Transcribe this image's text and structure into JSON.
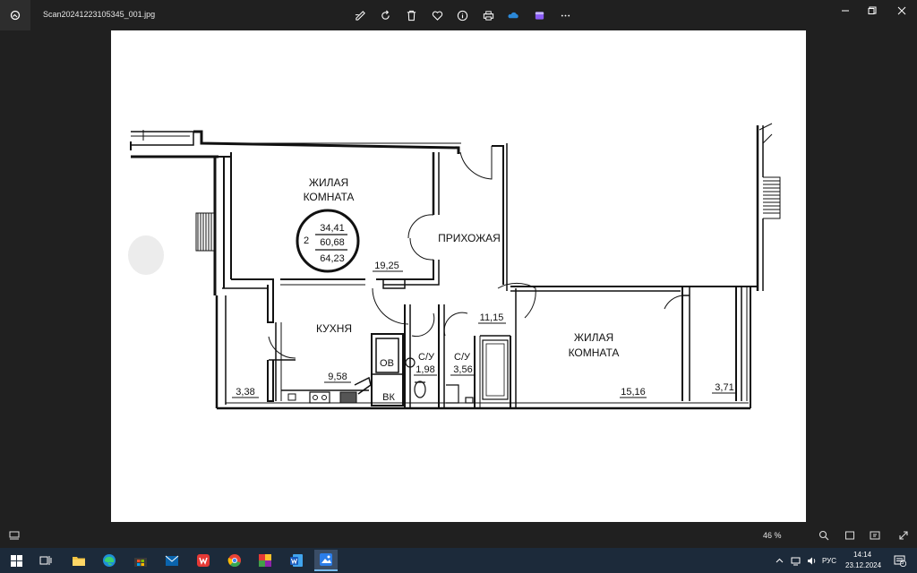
{
  "window": {
    "filename": "Scan20241223105345_001.jpg"
  },
  "toolbar": {
    "icons": [
      "edit-icon",
      "rotate-icon",
      "delete-icon",
      "favorite-icon",
      "info-icon",
      "print-icon",
      "onedrive-icon",
      "clipchamp-icon",
      "more-icon"
    ]
  },
  "plan": {
    "room1_name_line1": "ЖИЛАЯ",
    "room1_name_line2": "КОМНАТА",
    "badge_number": "2",
    "area_living": "34,41",
    "area_total": "60,68",
    "area_full": "64,23",
    "room1_area": "19,25",
    "hall_name": "ПРИХОЖАЯ",
    "hall_area": "11,15",
    "kitchen_name": "КУХНЯ",
    "kitchen_area": "9,58",
    "balcony_left_area": "3,38",
    "oven_label": "ОВ",
    "ventilation_label": "ВК",
    "bath1_name": "С/У",
    "bath1_area": "1,98",
    "bath2_name": "С/У",
    "bath2_area": "3,56",
    "room2_name_line1": "ЖИЛАЯ",
    "room2_name_line2": "КОМНАТА",
    "room2_area": "15,16",
    "balcony_right_area": "3,71"
  },
  "status": {
    "zoom": "46 %"
  },
  "tray": {
    "lang": "РУС",
    "time": "14:14",
    "date": "23.12.2024",
    "notifications": "5"
  }
}
